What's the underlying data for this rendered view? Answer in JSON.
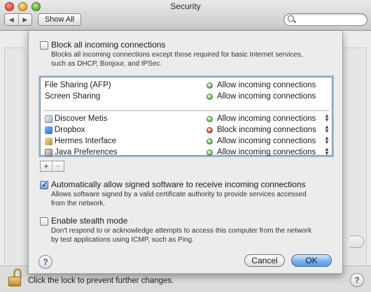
{
  "window": {
    "title": "Security",
    "show_all": "Show All",
    "back_glyph": "◀",
    "forward_glyph": "▶"
  },
  "search": {
    "placeholder": ""
  },
  "firewall_sheet": {
    "block_all": {
      "label": "Block all incoming connections",
      "description": "Blocks all incoming connections except those required for basic Internet services, such as DHCP, Bonjour, and IPSec.",
      "checked": false
    },
    "services": [
      {
        "name": "File Sharing (AFP)",
        "status": "Allow incoming connections",
        "status_color": "#4caf3a"
      },
      {
        "name": "Screen Sharing",
        "status": "Allow incoming connections",
        "status_color": "#4caf3a"
      }
    ],
    "apps": [
      {
        "name": "Discover Metis",
        "icon": "discover-metis-icon",
        "status": "Allow incoming connections",
        "status_color": "#4caf3a"
      },
      {
        "name": "Dropbox",
        "icon": "dropbox-icon",
        "status": "Block incoming connections",
        "status_color": "#d42a2a"
      },
      {
        "name": "Hermes Interface",
        "icon": "hermes-icon",
        "status": "Allow incoming connections",
        "status_color": "#4caf3a"
      },
      {
        "name": "Java Preferences",
        "icon": "java-icon",
        "status": "Allow incoming connections",
        "status_color": "#4caf3a"
      }
    ],
    "add_glyph": "+",
    "remove_glyph": "−",
    "signed_software": {
      "label": "Automatically allow signed software to receive incoming connections",
      "description": "Allows software signed by a valid certificate authority to provide services accessed from the network.",
      "checked": true
    },
    "stealth_mode": {
      "label": "Enable stealth mode",
      "description": "Don't respond to or acknowledge attempts to access this computer from the network by test applications using ICMP, such as Ping.",
      "checked": false
    },
    "help_glyph": "?",
    "cancel": "Cancel",
    "ok": "OK"
  },
  "footer": {
    "lock_text": "Click the lock to prevent further changes.",
    "help_glyph": "?"
  }
}
